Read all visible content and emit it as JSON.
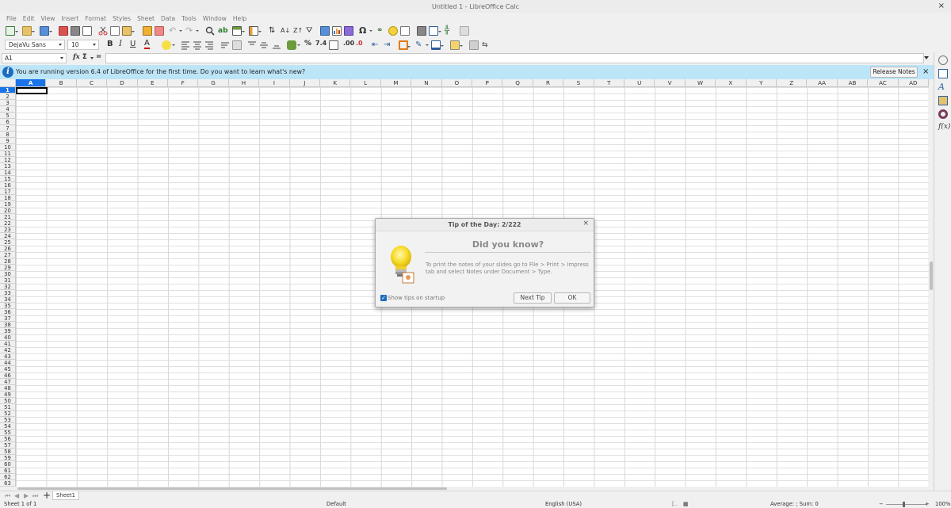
{
  "window": {
    "title": "Untitled 1 - LibreOffice Calc",
    "close_glyph": "×"
  },
  "menu": [
    "File",
    "Edit",
    "View",
    "Insert",
    "Format",
    "Styles",
    "Sheet",
    "Data",
    "Tools",
    "Window",
    "Help"
  ],
  "formatting": {
    "font_name": "DejaVu Sans",
    "font_size": "10"
  },
  "formula_bar": {
    "cell_ref": "A1",
    "fx_label": "fx",
    "sum_label": "Σ",
    "equals_label": "=",
    "content": ""
  },
  "infobar": {
    "message": "You are running version 6.4 of LibreOffice for the first time. Do you want to learn what's new?",
    "button": "Release Notes",
    "close_glyph": "×"
  },
  "grid": {
    "columns": [
      "A",
      "B",
      "C",
      "D",
      "E",
      "F",
      "G",
      "H",
      "I",
      "J",
      "K",
      "L",
      "M",
      "N",
      "O",
      "P",
      "Q",
      "R",
      "S",
      "T",
      "U",
      "V",
      "W",
      "X",
      "Y",
      "Z",
      "AA",
      "AB",
      "AC",
      "AD"
    ],
    "row_count": 63,
    "active_cell": "A1"
  },
  "sheets": [
    "Sheet1"
  ],
  "status": {
    "sheet_info": "Sheet 1 of 1",
    "page_style": "Default",
    "language": "English (USA)",
    "selection_summary": "Average: ; Sum: 0",
    "zoom": "100%"
  },
  "dialog": {
    "title": "Tip of the Day: 2/222",
    "heading": "Did you know?",
    "body": "To print the notes of your slides go to File > Print > Impress tab and select Notes under Document > Type.",
    "show_tips_label": "Show tips on startup",
    "show_tips_checked": true,
    "next_button": "Next Tip",
    "ok_button": "OK",
    "close_glyph": "×"
  },
  "colors": {
    "accent": "#1a73e8",
    "infobar": "#bde5f8",
    "info_icon": "#1e6cbf"
  }
}
